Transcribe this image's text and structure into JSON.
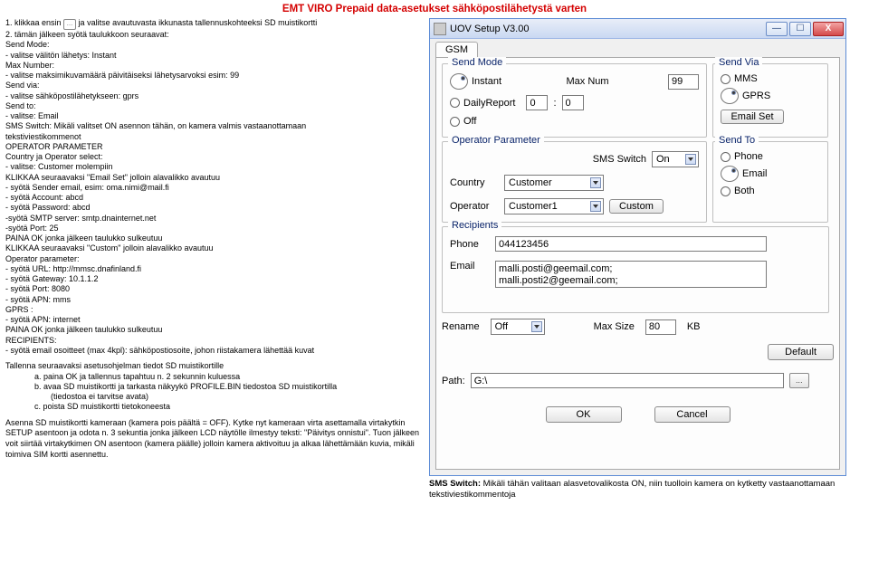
{
  "title": "EMT VIRO Prepaid data-asetukset sähköpostilähetystä varten",
  "left": {
    "step1_a": "1.   klikkaa ensin ",
    "step1_b": " ja valitse avautuvasta ikkunasta tallennuskohteeksi SD muistikortti",
    "step2": "2.   tämän jälkeen syötä taulukkoon seuraavat:",
    "sendmode": "Send Mode:",
    "sendmode_v": "- valitse välitön lähetys: Instant",
    "maxnum": "Max Number:",
    "maxnum_v": "- valitse maksimikuvamäärä päivitäiseksi lähetysarvoksi esim: 99",
    "sendvia": "Send via:",
    "sendvia_v": "- valitse sähköpostilähetykseen: gprs",
    "sendto": "Send to:",
    "sendto_v": "- valitse: Email",
    "sms_a": "SMS Switch: Mikäli valitset ON asennon tähän, on kamera valmis vastaanottamaan",
    "sms_b": "tekstiviestikommenot",
    "oper": "OPERATOR PARAMETER",
    "country": "Country ja Operator select:",
    "country_v": "- valitse: Customer molempiin",
    "klik1": "KLIKKAA seuraavaksi \"Email Set\" jolloin alavalikko avautuu",
    "sender": " - syötä Sender email, esim: oma.nimi@mail.fi",
    "account": " - syötä Account: abcd",
    "password": "  - syötä Password: abcd",
    "smtp": " -syötä SMTP server: smtp.dnainternet.net",
    "port": " -syötä Port: 25",
    "paina_ok": "PAINA OK jonka jälkeen taulukko sulkeutuu",
    "klik2": "KLIKKAA seuraavaksi \"Custom\" jolloin alavalikko avautuu",
    "opparam": "Operator parameter:",
    "url": "  - syötä URL: http://mmsc.dnafinland.fi",
    "gateway": " - syötä Gateway: 10.1.1.2",
    "port2": " - syötä Port: 8080",
    "apn": " - syötä APN: mms",
    "gprs": "GPRS :",
    "apn2": " - syötä APN: internet",
    "paina_ok2": "PAINA OK jonka jälkeen taulukko sulkeutuu",
    "recip": "RECIPIENTS:",
    "recip_v": "  - syötä email osoitteet (max 4kpl): sähköpostiosoite, johon riistakamera lähettää kuvat",
    "save": "Tallenna seuraavaksi asetusohjelman tiedot SD muistikortille",
    "save_a": "a.   paina OK ja tallennus tapahtuu n. 2 sekunnin kuluessa",
    "save_b1": "b.   avaa SD muistikortti ja tarkasta näkyykö PROFILE.BIN tiedostoa SD muistikortilla",
    "save_b2": "(tiedostoa ei tarvitse avata)",
    "save_c": "c.   poista SD muistikortti tietokoneesta",
    "asenna": "Asenna SD muistikortti kameraan (kamera pois päältä = OFF). Kytke nyt kameraan virta asettamalla virtakytkin SETUP asentoon ja odota n. 3 sekuntia jonka jälkeen LCD näytölle ilmestyy teksti: \"Päivitys onnistui\". Tuon jälkeen voit siirtää virtakytkimen ON asentoon (kamera päälle) jolloin kamera aktivoituu ja alkaa lähettämään kuvia, mikäli toimiva SIM kortti asennettu."
  },
  "window": {
    "title": "UOV Setup V3.00",
    "tab": "GSM",
    "sendmode_legend": "Send Mode",
    "instant": "Instant",
    "dailyreport": "DailyReport",
    "off": "Off",
    "maxnum_label": "Max Num",
    "maxnum_val": "99",
    "dr_h": "0",
    "dr_m": "0",
    "sendvia_legend": "Send Via",
    "mms": "MMS",
    "gprs_opt": "GPRS",
    "emailset_btn": "Email Set",
    "oper_legend": "Operator Parameter",
    "smsswitch_label": "SMS Switch",
    "smsswitch_val": "On",
    "country_label": "Country",
    "country_val": "Customer",
    "operator_label": "Operator",
    "operator_val": "Customer1",
    "custom_btn": "Custom",
    "sendto_legend": "Send To",
    "phone_opt": "Phone",
    "email_opt": "Email",
    "both_opt": "Both",
    "recip_legend": "Recipients",
    "phone_label": "Phone",
    "phone_val": "044123456",
    "email_label": "Email",
    "email_val": "malli.posti@geemail.com;\nmalli.posti2@geemail.com;",
    "rename_label": "Rename",
    "rename_val": "Off",
    "maxsize_label": "Max Size",
    "maxsize_val": "80",
    "kb": "KB",
    "default_btn": "Default",
    "path_label": "Path:",
    "path_val": "G:\\",
    "ok": "OK",
    "cancel": "Cancel"
  },
  "footnote": {
    "bold": "SMS Switch:",
    "text": " Mikäli tähän valitaan alasvetovalikosta ON, niin tuolloin kamera on kytketty vastaanottamaan tekstiviestikommentoja"
  }
}
